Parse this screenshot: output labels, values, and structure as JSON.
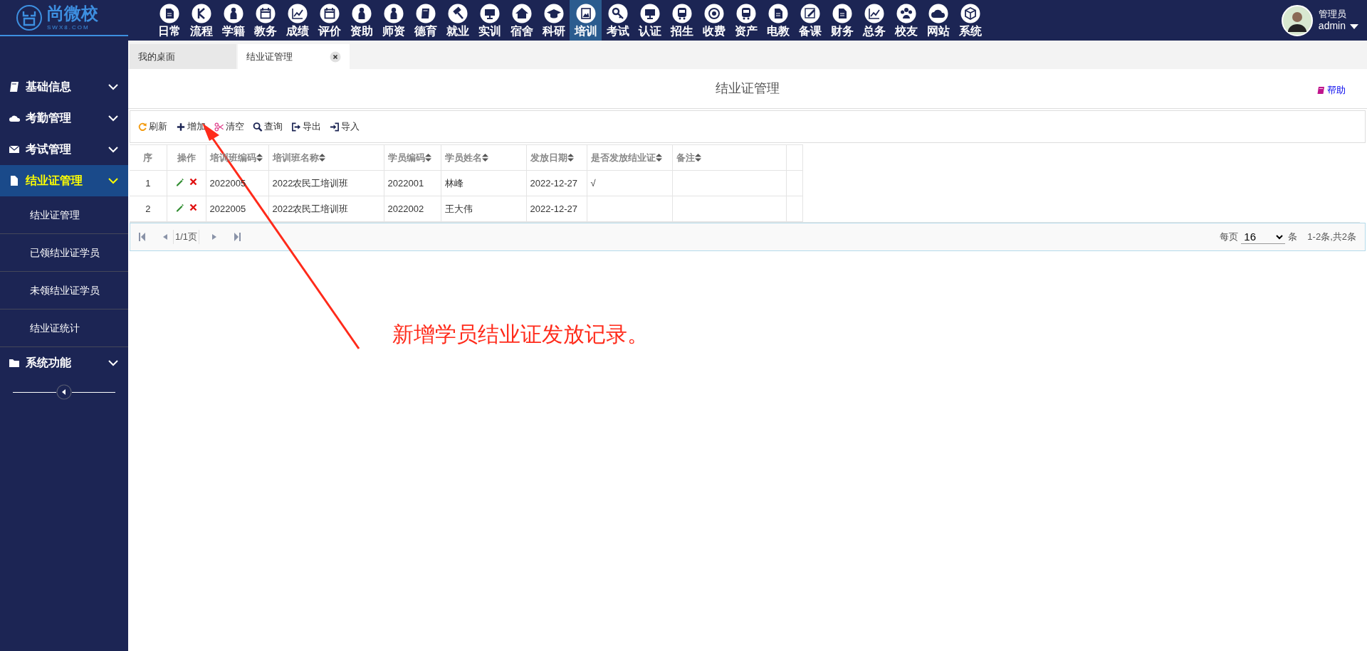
{
  "logo": {
    "name": "尚微校",
    "sub": "SWX8.COM"
  },
  "top_nav": [
    {
      "label": "日常",
      "selected": false
    },
    {
      "label": "流程",
      "selected": false
    },
    {
      "label": "学籍",
      "selected": false
    },
    {
      "label": "教务",
      "selected": false
    },
    {
      "label": "成绩",
      "selected": false
    },
    {
      "label": "评价",
      "selected": false
    },
    {
      "label": "资助",
      "selected": false
    },
    {
      "label": "师资",
      "selected": false
    },
    {
      "label": "德育",
      "selected": false
    },
    {
      "label": "就业",
      "selected": false
    },
    {
      "label": "实训",
      "selected": false
    },
    {
      "label": "宿舍",
      "selected": false
    },
    {
      "label": "科研",
      "selected": false
    },
    {
      "label": "培训",
      "selected": true
    },
    {
      "label": "考试",
      "selected": false
    },
    {
      "label": "认证",
      "selected": false
    },
    {
      "label": "招生",
      "selected": false
    },
    {
      "label": "收费",
      "selected": false
    },
    {
      "label": "资产",
      "selected": false
    },
    {
      "label": "电教",
      "selected": false
    },
    {
      "label": "备课",
      "selected": false
    },
    {
      "label": "财务",
      "selected": false
    },
    {
      "label": "总务",
      "selected": false
    },
    {
      "label": "校友",
      "selected": false
    },
    {
      "label": "网站",
      "selected": false
    },
    {
      "label": "系统",
      "selected": false
    }
  ],
  "user": {
    "role": "管理员",
    "name": "admin"
  },
  "sidebar": {
    "items": [
      {
        "label": "基础信息",
        "selected": false
      },
      {
        "label": "考勤管理",
        "selected": false
      },
      {
        "label": "考试管理",
        "selected": false
      },
      {
        "label": "结业证管理",
        "selected": true,
        "children": [
          {
            "label": "结业证管理",
            "selected": false
          },
          {
            "label": "已领结业证学员",
            "selected": false
          },
          {
            "label": "未领结业证学员",
            "selected": false
          },
          {
            "label": "结业证统计",
            "selected": false
          }
        ]
      },
      {
        "label": "系统功能",
        "selected": false
      }
    ]
  },
  "tabs": [
    {
      "label": "我的桌面",
      "selected": false,
      "closable": false
    },
    {
      "label": "结业证管理",
      "selected": true,
      "closable": true
    }
  ],
  "page_title": "结业证管理",
  "help": "帮助",
  "toolbar": [
    {
      "label": "刷新"
    },
    {
      "label": "增加"
    },
    {
      "label": "清空"
    },
    {
      "label": "查询"
    },
    {
      "label": "导出"
    },
    {
      "label": "导入"
    }
  ],
  "table": {
    "columns": [
      {
        "label": "序",
        "sortable": false
      },
      {
        "label": "操作",
        "sortable": false
      },
      {
        "label": "培训班编码",
        "sortable": true
      },
      {
        "label": "培训班名称",
        "sortable": true
      },
      {
        "label": "学员编码",
        "sortable": true
      },
      {
        "label": "学员姓名",
        "sortable": true
      },
      {
        "label": "发放日期",
        "sortable": true
      },
      {
        "label": "是否发放结业证",
        "sortable": true
      },
      {
        "label": "备注",
        "sortable": true
      }
    ],
    "rows": [
      {
        "no": "1",
        "class_code": "2022005",
        "class_name": "2022农民工培训班",
        "student_code": "2022001",
        "student_name": "林峰",
        "issue_date": "2022-12-27",
        "issued": "√"
      },
      {
        "no": "2",
        "class_code": "2022005",
        "class_name": "2022农民工培训班",
        "student_code": "2022002",
        "student_name": "王大伟",
        "issue_date": "2022-12-27"
      }
    ]
  },
  "pager": {
    "page": "1/1页",
    "per_page_label": "每页",
    "per_page": "16",
    "unit": "条",
    "summary": "1-2条,共2条"
  },
  "annotation": {
    "text": "新增学员结业证发放记录。"
  }
}
